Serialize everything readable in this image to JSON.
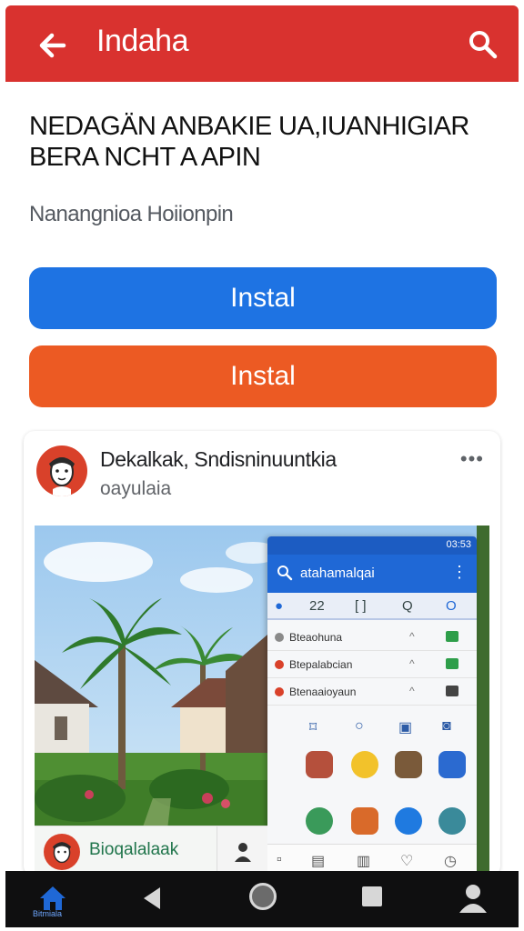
{
  "appbar": {
    "title": "Indaha",
    "back_icon": "back-arrow-icon",
    "search_icon": "search-icon",
    "color": "#d9322f"
  },
  "headline": "NEDAGÄN ANBAKIE UA,IUANHIGIAR BERA NCHT A APIN",
  "subtext": "Nanangnioa Hoiionpin",
  "buttons": {
    "primary_label": "Instal",
    "secondary_label": "Instal",
    "primary_color": "#1e73e3",
    "secondary_color": "#ec5a23"
  },
  "card": {
    "name": "Dekalkak, Sndisninuuntkia",
    "subtitle": "oayulaia",
    "more_icon": "more-horizontal-icon",
    "footer_label": "Bioqalalaak",
    "footer_icon": "person-icon"
  },
  "phone": {
    "time": "03:53",
    "search_text": "atahamalqai",
    "tabs": [
      "22",
      "[ ]",
      "Q",
      "O"
    ],
    "rows": [
      {
        "label": "Bteaohuna",
        "dot": "#8a8a8a",
        "icon": "#2e9e4a"
      },
      {
        "label": "Btepalabcian",
        "dot": "#d9412a",
        "icon": "#2e9e4a"
      },
      {
        "label": "Btenaaioyaun",
        "dot": "#d9412a",
        "icon": "#444444"
      }
    ]
  },
  "sysnav": {
    "home_label": "Bitmiala"
  }
}
